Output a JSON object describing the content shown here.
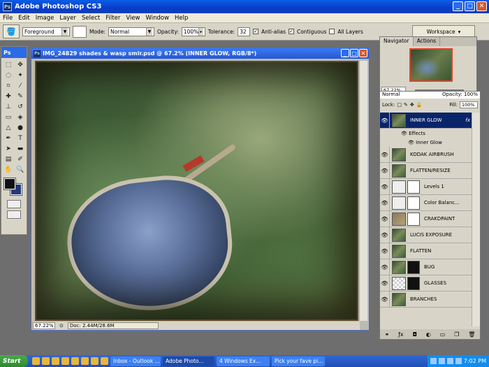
{
  "app": {
    "title": "Adobe Photoshop CS3",
    "icon": "Ps"
  },
  "menu": [
    "File",
    "Edit",
    "Image",
    "Layer",
    "Select",
    "Filter",
    "View",
    "Window",
    "Help"
  ],
  "options": {
    "fill_source": "Foreground",
    "mode_label": "Mode:",
    "mode_value": "Normal",
    "opacity_label": "Opacity:",
    "opacity_value": "100%",
    "tolerance_label": "Tolerance:",
    "tolerance_value": "32",
    "antialias_label": "Anti-alias",
    "contiguous_label": "Contiguous",
    "all_layers_label": "All Layers",
    "workspace_label": "Workspace"
  },
  "toolbox": {
    "header": "Ps",
    "fg_color": "#111111",
    "bg_color": "#1f3a78"
  },
  "document": {
    "title": "IMG_24829 shades & wasp smlr.psd @ 67.2% (INNER GLOW, RGB/8*)",
    "zoom": "67.22%",
    "doc_info": "Doc: 2.44M/28.6M"
  },
  "navigator": {
    "tab_navigator": "Navigator",
    "tab_actions": "Actions",
    "zoom": "67.22%"
  },
  "layers": {
    "blend_mode": "Normal",
    "opacity_label": "Opacity:",
    "opacity_value": "100%",
    "lock_label": "Lock:",
    "fill_label": "Fill:",
    "fill_value": "100%",
    "effects_label": "Effects",
    "effect_inner_glow": "Inner Glow",
    "items": [
      {
        "name": "INNER GLOW",
        "fx": "fx"
      },
      {
        "name": "KODAK AIRBRUSH"
      },
      {
        "name": "FLATTEN/RESIZE"
      },
      {
        "name": "Levels 1"
      },
      {
        "name": "Color Balanc..."
      },
      {
        "name": "CRAKDPAINT"
      },
      {
        "name": "LUCIS EXPOSURE"
      },
      {
        "name": "FLATTEN"
      },
      {
        "name": "BUG"
      },
      {
        "name": "GLASSES"
      },
      {
        "name": "BRANCHES"
      }
    ]
  },
  "taskbar": {
    "start": "Start",
    "tasks": [
      "Inbox - Outlook ...",
      "Adobe Photo...",
      "4 Windows Ex...",
      "Pick your fave pi..."
    ],
    "clock": "7:02 PM"
  }
}
